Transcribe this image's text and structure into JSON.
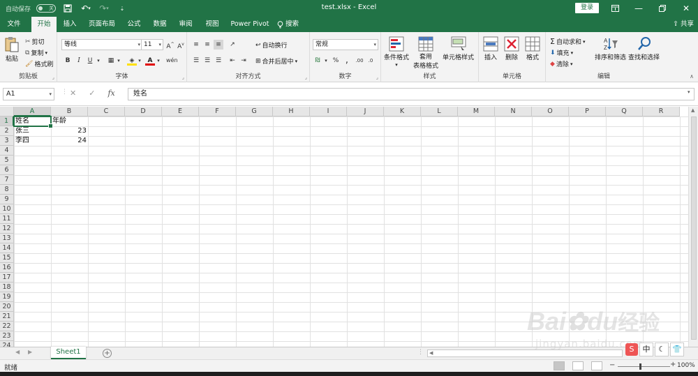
{
  "titlebar": {
    "autosave_label": "自动保存",
    "autosave_state": "关",
    "title": "test.xlsx  -  Excel",
    "login": "登录"
  },
  "tabs": [
    {
      "label": "文件"
    },
    {
      "label": "开始"
    },
    {
      "label": "插入"
    },
    {
      "label": "页面布局"
    },
    {
      "label": "公式"
    },
    {
      "label": "数据"
    },
    {
      "label": "审阅"
    },
    {
      "label": "视图"
    },
    {
      "label": "Power Pivot"
    },
    {
      "label": "搜索"
    }
  ],
  "share": "共享",
  "ribbon": {
    "clipboard": {
      "label": "剪贴板",
      "paste": "粘贴",
      "cut": "剪切",
      "copy": "复制",
      "format_painter": "格式刷"
    },
    "font": {
      "label": "字体",
      "font_name": "等线",
      "font_size": "11"
    },
    "alignment": {
      "label": "对齐方式",
      "wrap": "自动换行",
      "merge": "合并后居中"
    },
    "number": {
      "label": "数字",
      "format": "常规"
    },
    "styles": {
      "label": "样式",
      "cond": "条件格式",
      "table1": "套用",
      "table2": "表格格式",
      "cell_styles": "单元格样式"
    },
    "cells": {
      "label": "单元格",
      "insert": "插入",
      "delete": "删除",
      "format": "格式"
    },
    "editing": {
      "label": "编辑",
      "autosum": "自动求和",
      "fill": "填充",
      "clear": "清除",
      "sort": "排序和筛选",
      "find": "查找和选择"
    }
  },
  "formula_bar": {
    "name_box": "A1",
    "content": "姓名"
  },
  "columns": [
    "A",
    "B",
    "C",
    "D",
    "E",
    "F",
    "G",
    "H",
    "I",
    "J",
    "K",
    "L",
    "M",
    "N",
    "O",
    "P",
    "Q",
    "R"
  ],
  "rows": [
    "1",
    "2",
    "3",
    "4",
    "5",
    "6",
    "7",
    "8",
    "9",
    "10",
    "11",
    "12",
    "13",
    "14",
    "15",
    "16",
    "17",
    "18",
    "19",
    "20",
    "21",
    "22",
    "23",
    "24"
  ],
  "cells": {
    "a1": "姓名",
    "b1": "年龄",
    "a2": "张三",
    "b2": "23",
    "a3": "李四",
    "b3": "24"
  },
  "sheets": [
    {
      "name": "Sheet1"
    }
  ],
  "status": {
    "ready": "就绪",
    "zoom": "100%"
  },
  "watermark": {
    "brand": "Bai",
    "brand2": "du",
    "cn": "经验",
    "url": "jingyan.baidu.com"
  },
  "ime": {
    "mode": "中"
  }
}
